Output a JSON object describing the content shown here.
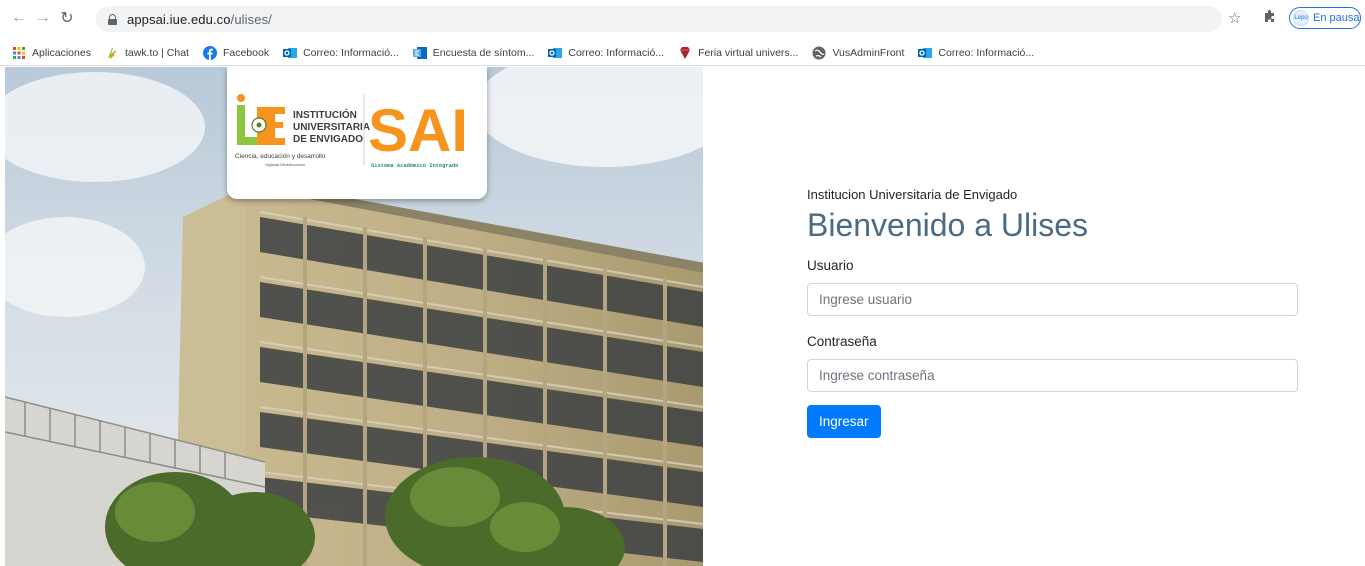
{
  "browser": {
    "url_host": "appsai.iue.edu.co",
    "url_path": "/ulises/",
    "profile_status": "En pausa",
    "profile_avatar_text": "Lepo"
  },
  "bookmarks": [
    {
      "label": "Aplicaciones",
      "icon": "apps-grid-icon"
    },
    {
      "label": "tawk.to | Chat",
      "icon": "tawk-icon"
    },
    {
      "label": "Facebook",
      "icon": "facebook-icon"
    },
    {
      "label": "Correo: Informació...",
      "icon": "outlook-icon"
    },
    {
      "label": "Encuesta de síntom...",
      "icon": "forms-icon"
    },
    {
      "label": "Correo: Informació...",
      "icon": "outlook-icon"
    },
    {
      "label": "Feria virtual univers...",
      "icon": "diamond-icon"
    },
    {
      "label": "VusAdminFront",
      "icon": "globe-icon"
    },
    {
      "label": "Correo: Informació...",
      "icon": "outlook-icon"
    }
  ],
  "logo": {
    "institution_line1": "INSTITUCIÓN",
    "institution_line2": "UNIVERSITARIA",
    "institution_line3": "DE ENVIGADO",
    "tagline": "Ciencia, educación y desarrollo",
    "sub_tagline": "Vigilada Mineducación",
    "brand": "SAI",
    "brand_subtitle": "Sistema Académico Integrado"
  },
  "login": {
    "institution": "Institucion Universitaria de Envigado",
    "welcome": "Bienvenido a Ulises",
    "user_label": "Usuario",
    "user_placeholder": "Ingrese usuario",
    "password_label": "Contraseña",
    "password_placeholder": "Ingrese contraseña",
    "submit_label": "Ingresar"
  },
  "colors": {
    "primary": "#007bff",
    "heading": "#4a6b86",
    "brand_orange": "#f7941d",
    "brand_green": "#8cc63f"
  }
}
